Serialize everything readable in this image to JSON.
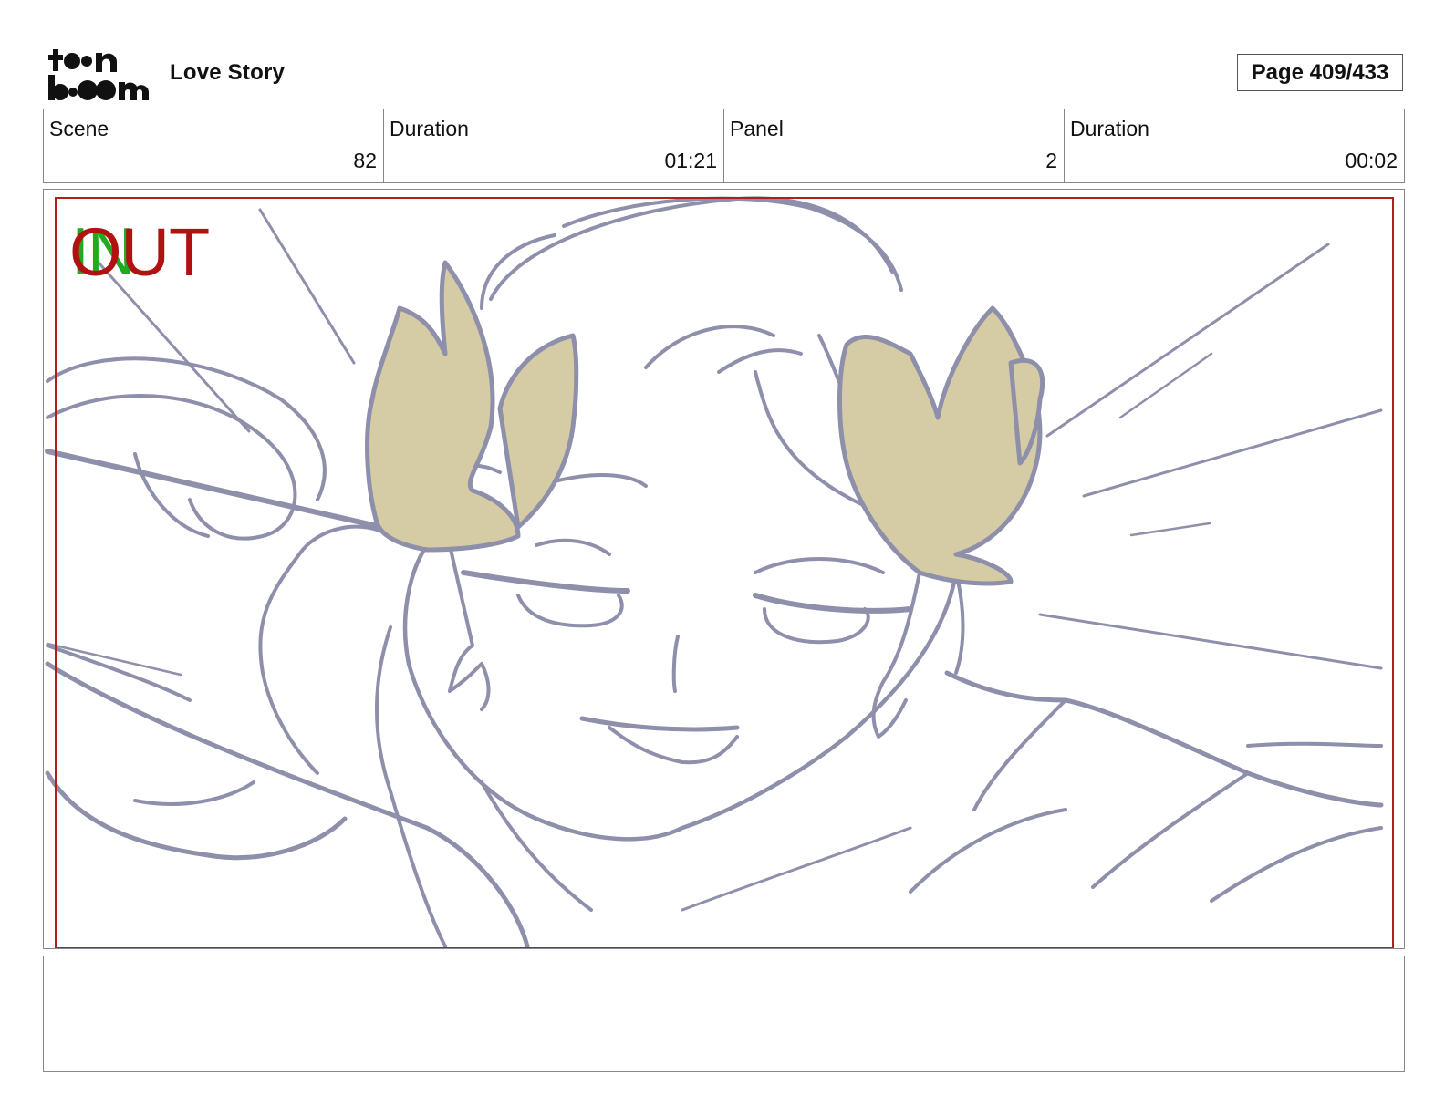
{
  "header": {
    "logo_text": "toon boom",
    "project_title": "Love Story",
    "page_label": "Page 409/433"
  },
  "info": [
    {
      "label": "Scene",
      "value": "82"
    },
    {
      "label": "Duration",
      "value": "01:21"
    },
    {
      "label": "Panel",
      "value": "2"
    },
    {
      "label": "Duration",
      "value": "00:02"
    }
  ],
  "panel": {
    "in_marker": "IN",
    "out_marker": "OUT",
    "colors": {
      "sketch_line": "#8e8fab",
      "flower_fill": "#d5ccA5",
      "safe_frame": "#b01e1e",
      "in": "#1faa1f",
      "out": "#b01212"
    }
  },
  "notes": {
    "text": ""
  }
}
